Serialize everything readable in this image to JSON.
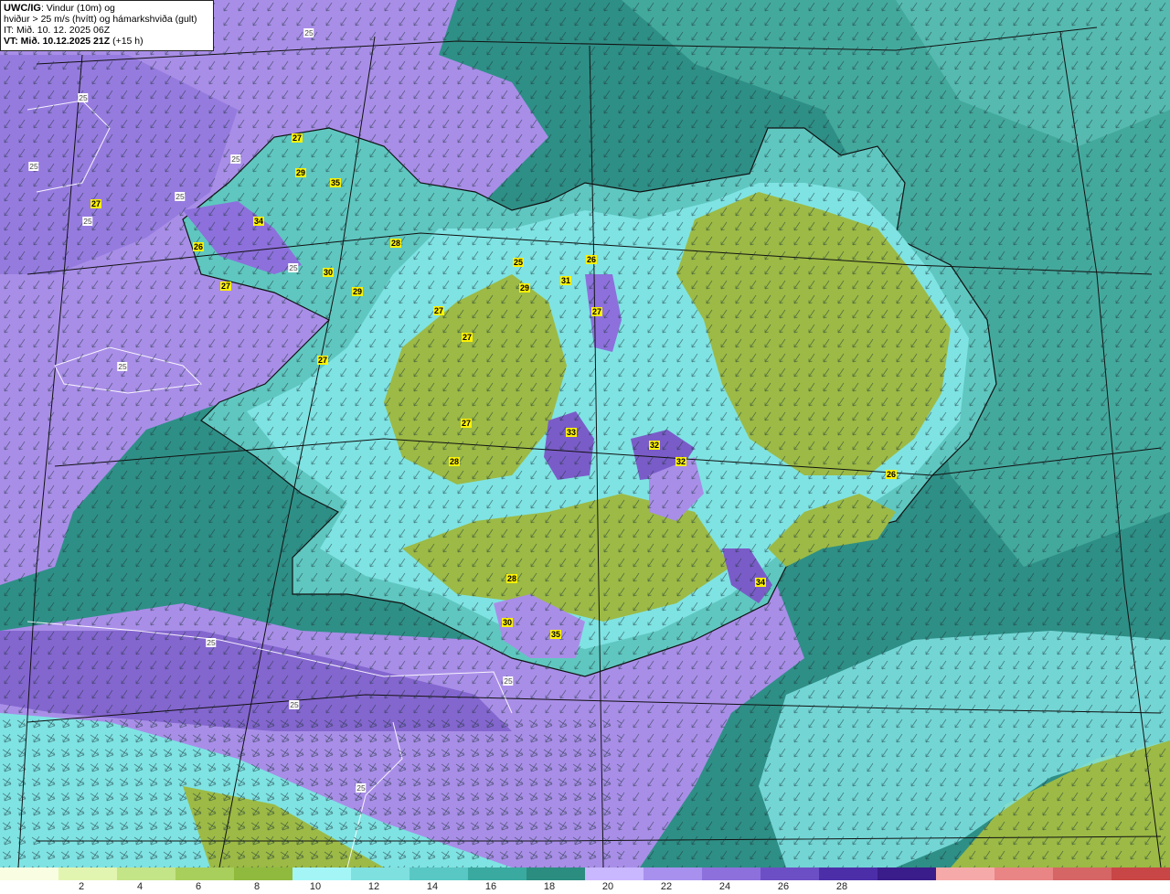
{
  "info": {
    "model": "UWC/IG",
    "line1_rest": ": Vindur (10m) og",
    "line2": "hviður > 25 m/s (hvítt) og hámarkshviða (gult)",
    "line3": "IT: Mið. 10. 12. 2025 06Z",
    "vt_bold": "VT: Mið. 10.12.2025 21Z",
    "vt_rest": " (+15 h)"
  },
  "colors": {
    "ocean_teal": "#2e8f86",
    "ocean_purple": "#a98ee8",
    "ocean_deep_purple": "#7a5cc8",
    "cyan": "#7fe3e3",
    "teal_mid": "#4fbcb4",
    "olive": "#9cba45",
    "land_outline": "#111111"
  },
  "legend": {
    "colors": [
      "#f9fde2",
      "#e2f5b0",
      "#c4e488",
      "#a8cf5c",
      "#8fba3e",
      "#a4f6f6",
      "#7fe0e0",
      "#59c8c4",
      "#3aa99f",
      "#2b8c80",
      "#c9b7ff",
      "#a890ef",
      "#8d70dc",
      "#6d4fc5",
      "#4c2fa8",
      "#3a1c8a",
      "#f6a9a9",
      "#e98585",
      "#d66565",
      "#c94646"
    ],
    "ticks": [
      "2",
      "4",
      "6",
      "8",
      "10",
      "12",
      "14",
      "16",
      "18",
      "20",
      "22",
      "24",
      "26",
      "28"
    ]
  },
  "max_gusts": [
    {
      "v": "27"
    },
    {
      "v": "29"
    },
    {
      "v": "35"
    },
    {
      "v": "34"
    },
    {
      "v": "27"
    },
    {
      "v": "26"
    },
    {
      "v": "28"
    },
    {
      "v": "30"
    },
    {
      "v": "29"
    },
    {
      "v": "27"
    },
    {
      "v": "27"
    },
    {
      "v": "27"
    },
    {
      "v": "27"
    },
    {
      "v": "25"
    },
    {
      "v": "29"
    },
    {
      "v": "26"
    },
    {
      "v": "31"
    },
    {
      "v": "27"
    },
    {
      "v": "27"
    },
    {
      "v": "33"
    },
    {
      "v": "28"
    },
    {
      "v": "32"
    },
    {
      "v": "32"
    },
    {
      "v": "26"
    },
    {
      "v": "28"
    },
    {
      "v": "30"
    },
    {
      "v": "35"
    },
    {
      "v": "34"
    }
  ],
  "gust_contours": [
    {
      "v": "25"
    },
    {
      "v": "25"
    },
    {
      "v": "25"
    },
    {
      "v": "25"
    },
    {
      "v": "25"
    },
    {
      "v": "25"
    },
    {
      "v": "25"
    },
    {
      "v": "25"
    },
    {
      "v": "25"
    },
    {
      "v": "25"
    },
    {
      "v": "25"
    },
    {
      "v": "25"
    }
  ]
}
